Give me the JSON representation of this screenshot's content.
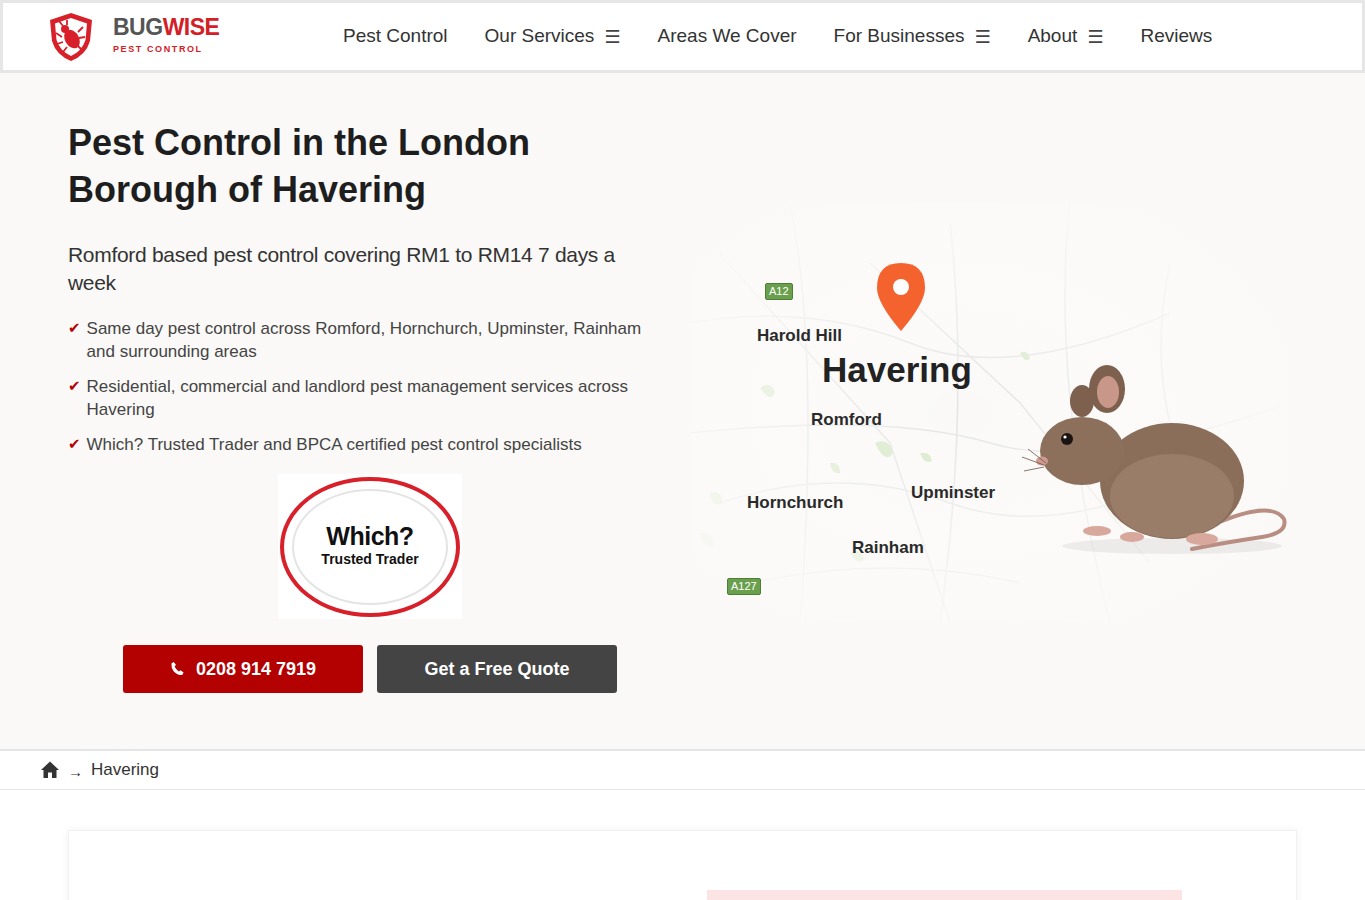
{
  "logo": {
    "brand_a": "BUG",
    "brand_b": "WISE",
    "tagline": "PEST CONTROL"
  },
  "nav": [
    {
      "label": "Pest Control",
      "icon": ""
    },
    {
      "label": "Our Services",
      "icon": "☰"
    },
    {
      "label": "Areas We Cover",
      "icon": ""
    },
    {
      "label": "For Businesses",
      "icon": "☰"
    },
    {
      "label": "About",
      "icon": "☰"
    },
    {
      "label": "Reviews",
      "icon": ""
    }
  ],
  "hero": {
    "title": "Pest Control in the London Borough of Havering",
    "subtitle": "Romford based pest control covering RM1 to RM14 7 days a week",
    "bullets": [
      {
        "icon": "✔",
        "text": "Same day pest control across Romford, Hornchurch, Upminster, Rainham and surrounding areas"
      },
      {
        "icon": "✔",
        "text": "Residential, commercial and landlord pest management services across Havering"
      },
      {
        "icon": "✔",
        "text": "Which? Trusted Trader and BPCA certified pest control specialists"
      }
    ],
    "badge": {
      "line1": "Which?",
      "line2": "Trusted Trader"
    },
    "call_button": "0208 914 7919",
    "quote_button": "Get a Free Quote"
  },
  "map": {
    "labels": [
      {
        "text": "A12",
        "kind": "road"
      },
      {
        "text": "Harold Hill",
        "kind": "place"
      },
      {
        "text": "Havering",
        "kind": "district"
      },
      {
        "text": "Romford",
        "kind": "place"
      },
      {
        "text": "Hornchurch",
        "kind": "place"
      },
      {
        "text": "Upminster",
        "kind": "place"
      },
      {
        "text": "Rainham",
        "kind": "place"
      },
      {
        "text": "A127",
        "kind": "road"
      }
    ]
  },
  "breadcrumb": {
    "separator": "→",
    "items": [
      "Havering"
    ]
  }
}
